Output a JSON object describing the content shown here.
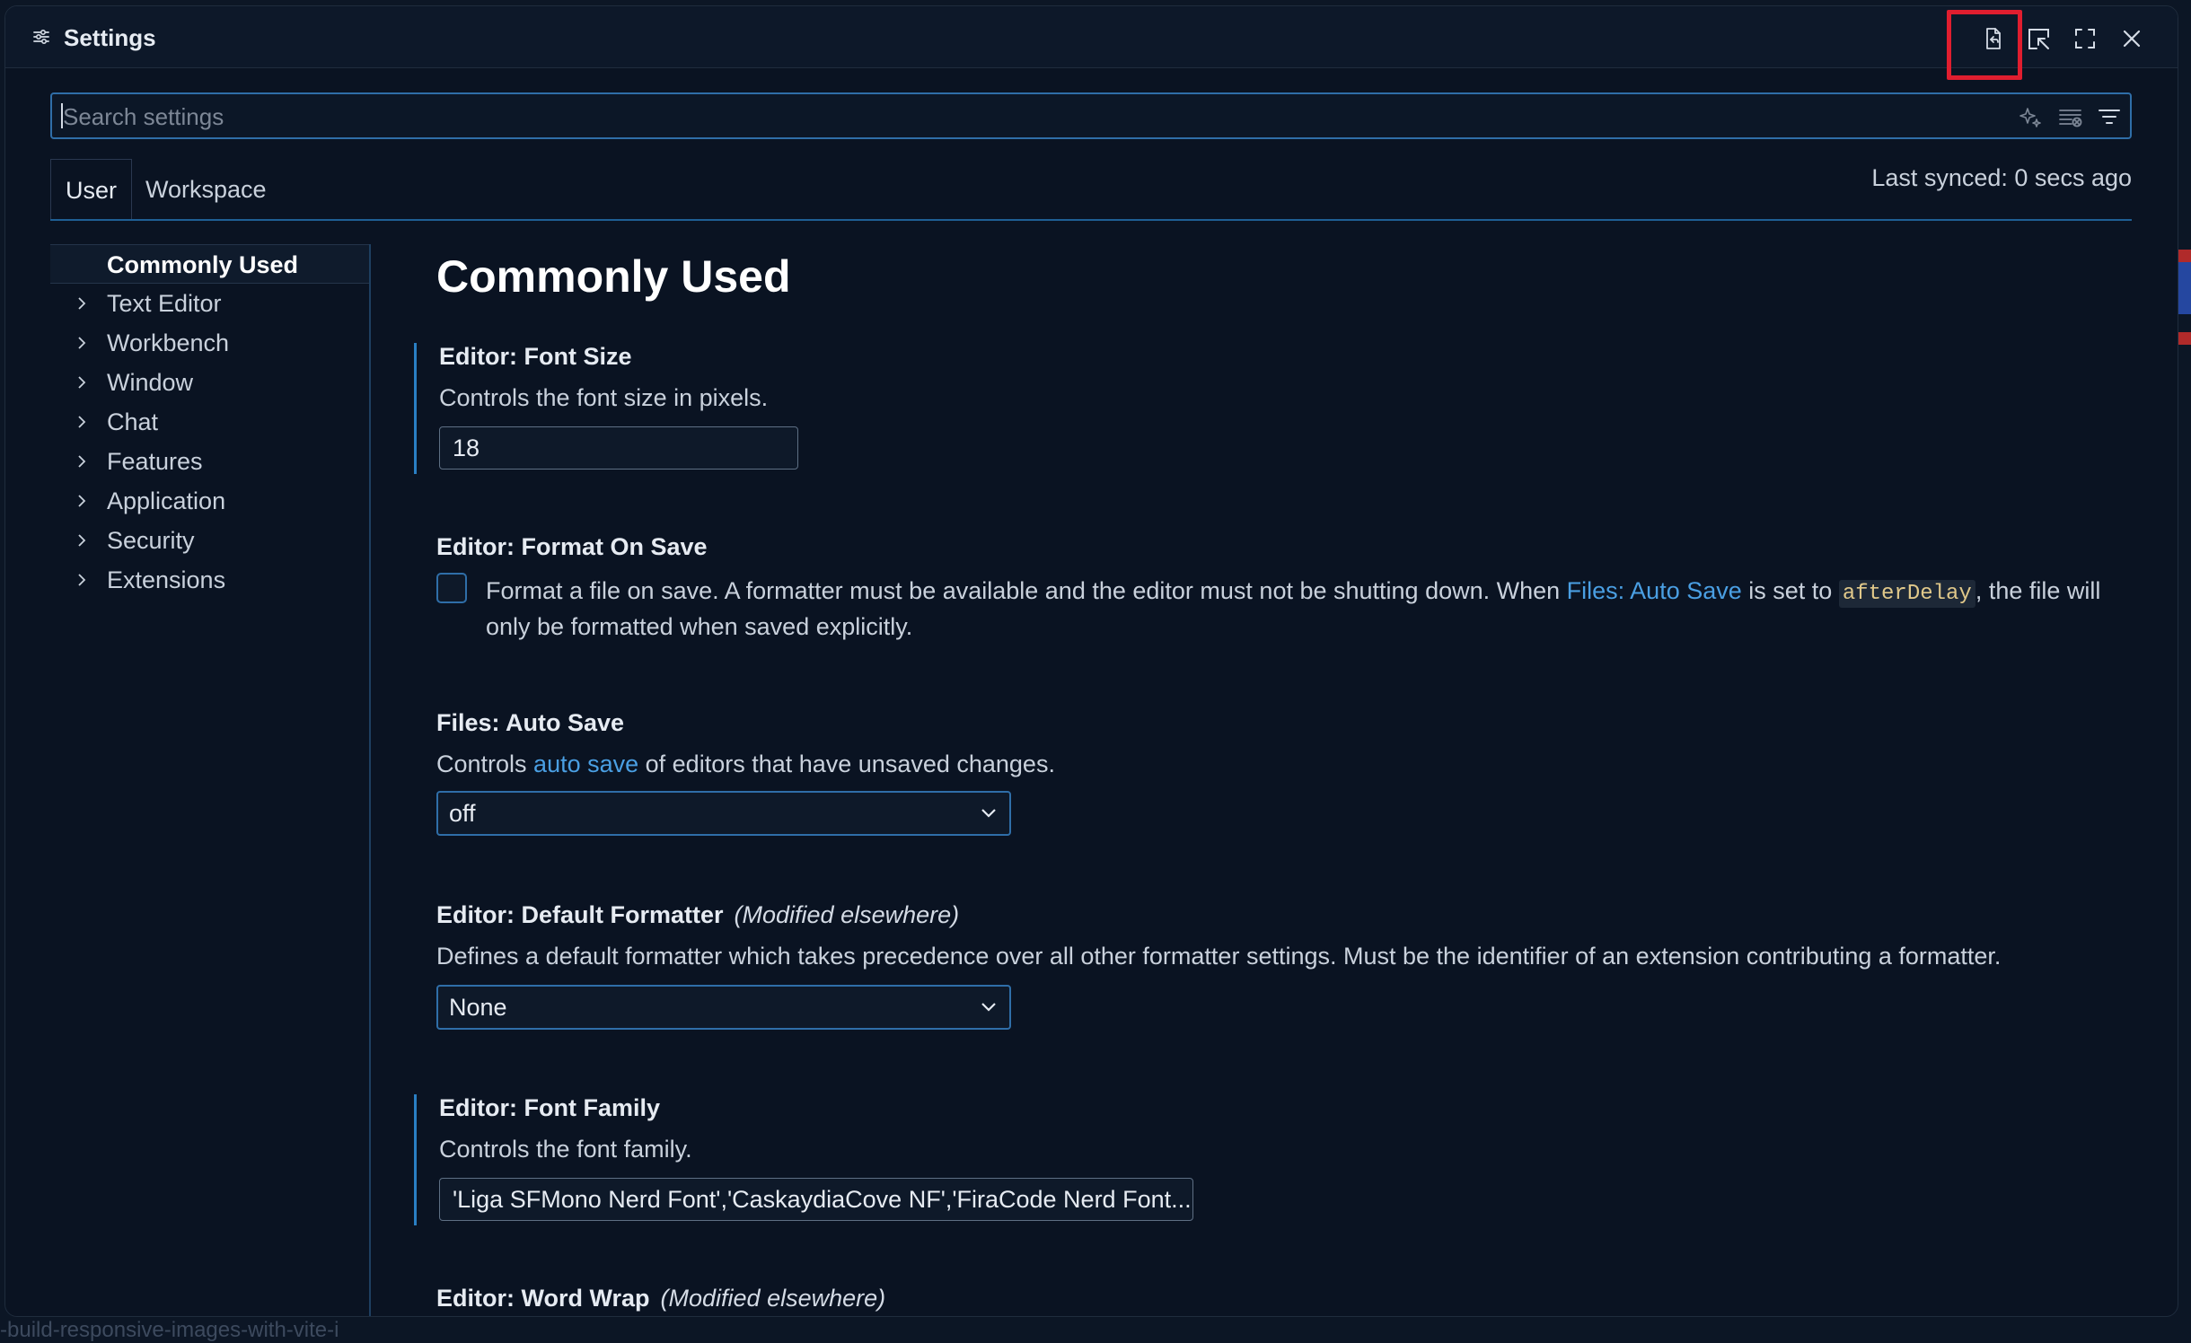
{
  "window": {
    "title": "Settings",
    "title_icon": "settings-sliders-icon",
    "toolbar_icons": [
      "open-settings-json-icon",
      "open-in-editor-icon",
      "maximize-icon",
      "close-icon"
    ],
    "highlight_color": "#e01e2f"
  },
  "search": {
    "placeholder": "Search settings",
    "value": "",
    "icons": [
      "ai-sparkle-icon",
      "clear-filter-icon",
      "filter-icon"
    ]
  },
  "tabs": [
    {
      "label": "User",
      "active": true
    },
    {
      "label": "Workspace",
      "active": false
    }
  ],
  "sync_status": "Last synced: 0 secs ago",
  "nav": {
    "items": [
      {
        "label": "Commonly Used",
        "active": true,
        "expandable": false
      },
      {
        "label": "Text Editor",
        "expandable": true
      },
      {
        "label": "Workbench",
        "expandable": true
      },
      {
        "label": "Window",
        "expandable": true
      },
      {
        "label": "Chat",
        "expandable": true
      },
      {
        "label": "Features",
        "expandable": true
      },
      {
        "label": "Application",
        "expandable": true
      },
      {
        "label": "Security",
        "expandable": true
      },
      {
        "label": "Extensions",
        "expandable": true
      }
    ]
  },
  "content": {
    "section_title": "Commonly Used",
    "settings": {
      "font_size": {
        "category": "Editor: ",
        "name": "Font Size",
        "description": "Controls the font size in pixels.",
        "value": "18",
        "modified": true
      },
      "format_on_save": {
        "category": "Editor: ",
        "name": "Format On Save",
        "desc_part1": "Format a file on save. A formatter must be available and the editor must not be shutting down. When ",
        "desc_link": "Files: Auto Save",
        "desc_part2": " is set to ",
        "desc_code": "afterDelay",
        "desc_part3": ", the file will only be formatted when saved explicitly.",
        "checked": false
      },
      "auto_save": {
        "category": "Files: ",
        "name": "Auto Save",
        "desc_part1": "Controls ",
        "desc_link": "auto save",
        "desc_part2": " of editors that have unsaved changes.",
        "value": "off"
      },
      "default_formatter": {
        "category": "Editor: ",
        "name": "Default Formatter",
        "note": "(Modified elsewhere)",
        "description": "Defines a default formatter which takes precedence over all other formatter settings. Must be the identifier of an extension contributing a formatter.",
        "value": "None"
      },
      "font_family": {
        "category": "Editor: ",
        "name": "Font Family",
        "description": "Controls the font family.",
        "value": "'Liga SFMono Nerd Font','CaskaydiaCove NF','FiraCode Nerd Font...",
        "modified": true
      },
      "word_wrap": {
        "category": "Editor: ",
        "name": "Word Wrap",
        "note": "(Modified elsewhere)"
      }
    }
  },
  "backdrop": {
    "bottom_text": "-build-responsive-images-with-vite-i"
  }
}
